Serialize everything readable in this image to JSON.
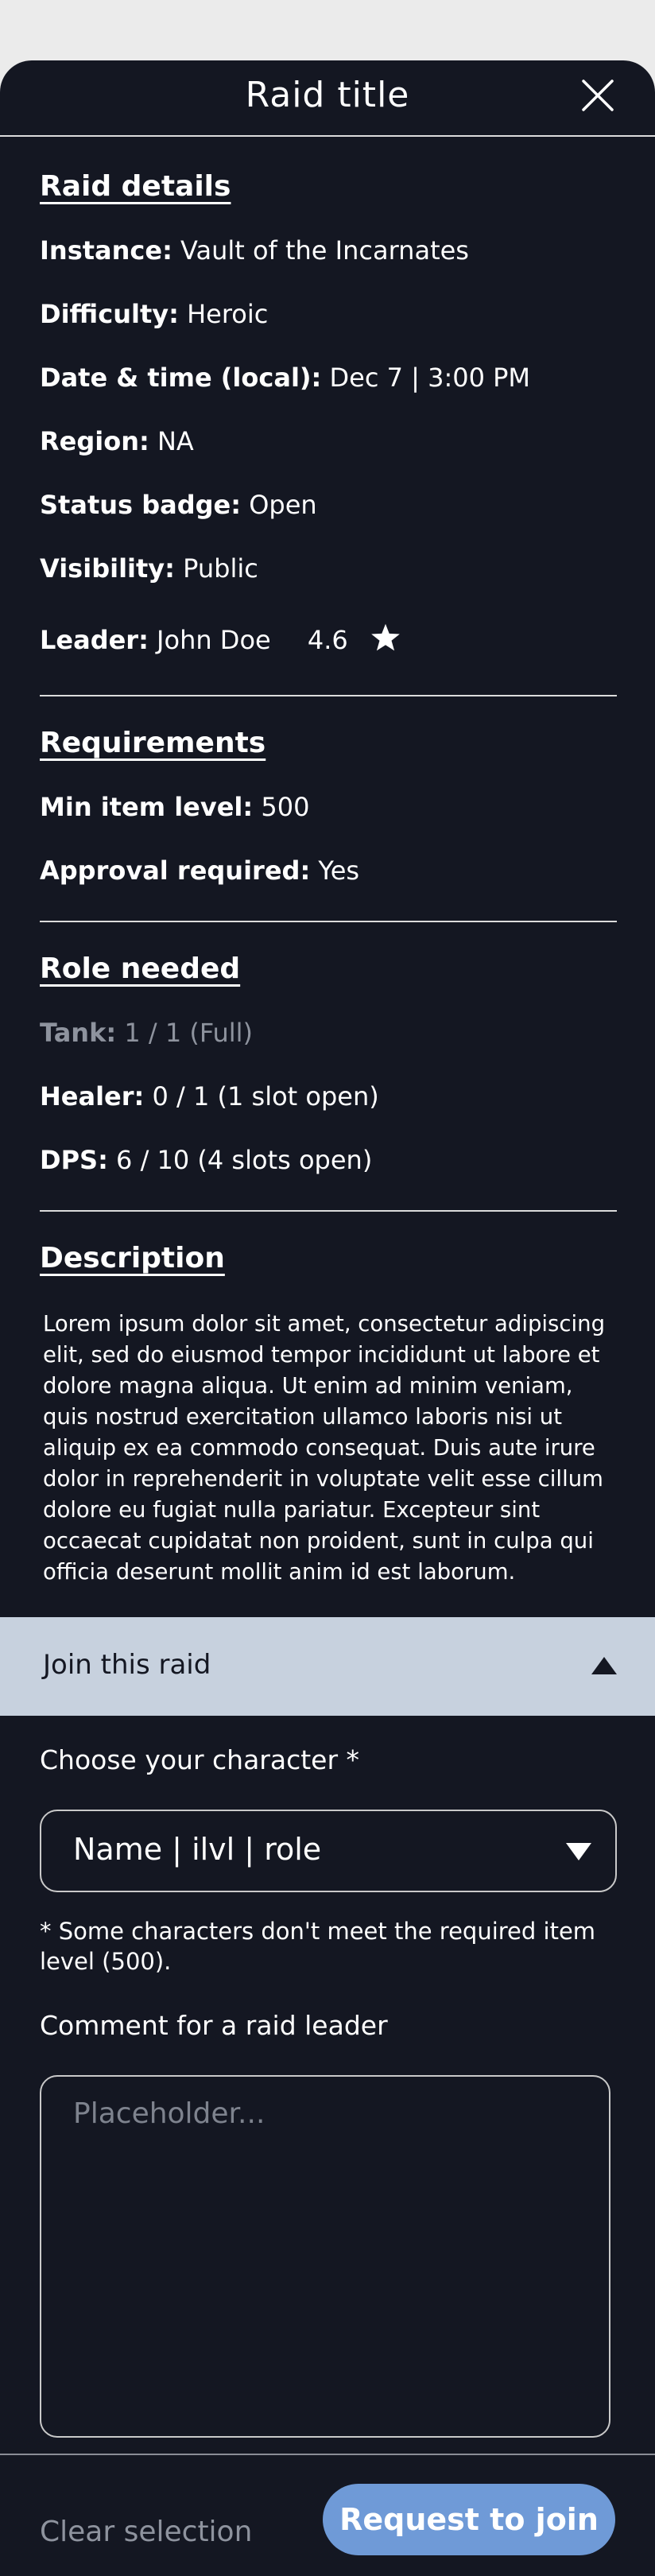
{
  "header": {
    "title": "Raid title"
  },
  "raid_details": {
    "heading": "Raid details",
    "instance_label": "Instance:",
    "instance_value": "Vault of the Incarnates",
    "difficulty_label": "Difficulty:",
    "difficulty_value": "Heroic",
    "datetime_label": "Date & time (local):",
    "datetime_value": "Dec 7 | 3:00 PM",
    "region_label": "Region:",
    "region_value": "NA",
    "status_label": "Status badge:",
    "status_value": "Open",
    "visibility_label": "Visibility:",
    "visibility_value": "Public",
    "leader_label": "Leader:",
    "leader_value": "John Doe",
    "leader_rating": "4.6"
  },
  "requirements": {
    "heading": "Requirements",
    "min_ilvl_label": "Min item level:",
    "min_ilvl_value": "500",
    "approval_label": "Approval required:",
    "approval_value": "Yes"
  },
  "roles": {
    "heading": "Role needed",
    "tank_label": "Tank:",
    "tank_value": "1 / 1 (Full)",
    "healer_label": "Healer:",
    "healer_value": "0 / 1 (1 slot open)",
    "dps_label": "DPS:",
    "dps_value": "6 / 10 (4 slots open)"
  },
  "description": {
    "heading": "Description",
    "text": "Lorem ipsum dolor sit amet, consectetur adipiscing elit, sed do eiusmod tempor incididunt ut labore et dolore magna aliqua. Ut enim ad minim veniam, quis nostrud exercitation ullamco laboris nisi ut aliquip ex ea commodo consequat. Duis aute irure dolor in reprehenderit in voluptate velit esse cillum dolore eu fugiat nulla pariatur. Excepteur sint occaecat cupidatat non proident, sunt in culpa qui officia deserunt mollit anim id est laborum."
  },
  "join": {
    "label": "Join this raid",
    "character_label": "Choose your character *",
    "character_value": "Name | ilvl | role",
    "note": "* Some characters don't meet the required item level (500).",
    "comment_label": "Comment for a raid leader",
    "comment_placeholder": "Placeholder..."
  },
  "footer": {
    "clear_label": "Clear selection",
    "request_label": "Request to join"
  },
  "colors": {
    "background": "#141722",
    "join_bar": "#c7d1de",
    "primary_button": "#6f9ad7",
    "muted_text": "#8e939e"
  },
  "icons": {
    "close": "close-icon",
    "rating": "star-icon",
    "collapse": "chevron-up-icon",
    "dropdown": "chevron-down-icon"
  }
}
